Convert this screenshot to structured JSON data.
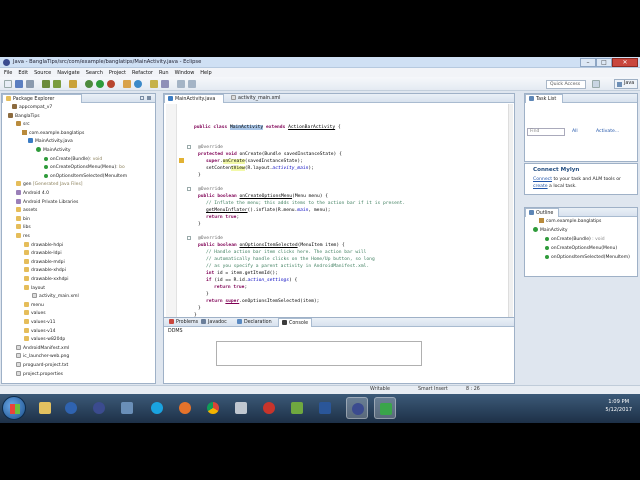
{
  "window": {
    "title": "Java - BanglaTips/src/com/example/banglatips/MainActivity.java - Eclipse",
    "controls": [
      "–",
      "□",
      "✕"
    ]
  },
  "menubar": {
    "items": [
      "File",
      "Edit",
      "Source",
      "Navigate",
      "Search",
      "Project",
      "Refactor",
      "Run",
      "Window",
      "Help"
    ]
  },
  "toolbar": {
    "quick_access": "Quick Access",
    "perspective": "Java"
  },
  "package_explorer": {
    "tab": "Package Explorer",
    "tree": [
      {
        "label": "appcompat_v7",
        "icon": "project",
        "suffix": ""
      },
      {
        "label": "BanglaTips",
        "icon": "project",
        "suffix": ""
      },
      {
        "label": "src",
        "icon": "source-folder",
        "suffix": ""
      },
      {
        "label": "com.example.banglatips",
        "icon": "package",
        "suffix": ""
      },
      {
        "label": "MainActivity.java",
        "icon": "java-file",
        "suffix": ""
      },
      {
        "label": "MainActivity",
        "icon": "class",
        "suffix": ""
      },
      {
        "label": "onCreate(Bundle)",
        "icon": "method",
        "suffix": ": void"
      },
      {
        "label": "onCreateOptionsMenu(Menu)",
        "icon": "method",
        "suffix": ": bo"
      },
      {
        "label": "onOptionsItemSelected(MenuItem",
        "icon": "method",
        "suffix": ""
      },
      {
        "label": "gen",
        "icon": "folder",
        "suffix": " [Generated Java Files]"
      },
      {
        "label": "Android 4.0",
        "icon": "library",
        "suffix": ""
      },
      {
        "label": "Android Private Libraries",
        "icon": "library",
        "suffix": ""
      },
      {
        "label": "assets",
        "icon": "folder",
        "suffix": ""
      },
      {
        "label": "bin",
        "icon": "folder",
        "suffix": ""
      },
      {
        "label": "libs",
        "icon": "folder",
        "suffix": ""
      },
      {
        "label": "res",
        "icon": "folder",
        "suffix": ""
      },
      {
        "label": "drawable-hdpi",
        "icon": "folder",
        "suffix": ""
      },
      {
        "label": "drawable-ldpi",
        "icon": "folder",
        "suffix": ""
      },
      {
        "label": "drawable-mdpi",
        "icon": "folder",
        "suffix": ""
      },
      {
        "label": "drawable-xhdpi",
        "icon": "folder",
        "suffix": ""
      },
      {
        "label": "drawable-xxhdpi",
        "icon": "folder",
        "suffix": ""
      },
      {
        "label": "layout",
        "icon": "folder",
        "suffix": ""
      },
      {
        "label": "activity_main.xml",
        "icon": "file",
        "suffix": ""
      },
      {
        "label": "menu",
        "icon": "folder",
        "suffix": ""
      },
      {
        "label": "values",
        "icon": "folder",
        "suffix": ""
      },
      {
        "label": "values-v11",
        "icon": "folder",
        "suffix": ""
      },
      {
        "label": "values-v14",
        "icon": "folder",
        "suffix": ""
      },
      {
        "label": "values-w820dp",
        "icon": "folder",
        "suffix": ""
      },
      {
        "label": "AndroidManifest.xml",
        "icon": "file",
        "suffix": ""
      },
      {
        "label": "ic_launcher-web.png",
        "icon": "file",
        "suffix": ""
      },
      {
        "label": "proguard-project.txt",
        "icon": "file",
        "suffix": ""
      },
      {
        "label": "project.properties",
        "icon": "file",
        "suffix": ""
      }
    ]
  },
  "editor": {
    "tabs": [
      "MainActivity.java",
      "activity_main.xml"
    ],
    "code": {
      "l1_kw": "public class ",
      "l1_cls": "MainActivity",
      "l1_ext": " extends ",
      "l1_super": "ActionBarActivity",
      "l1_end": " {",
      "override": "@Override",
      "l3_kw": "protected void ",
      "l3_name": "onCreate",
      "l3_params": "(Bundle savedInstanceState) {",
      "l4_super": "super",
      "l4_dot": ".",
      "l4_call": "onCreate",
      "l4_args": "(savedInstanceState);",
      "l5_a": "setConten",
      "l5_b": "tView",
      "l5_c": "(R.layout.",
      "l5_field": "activity_main",
      "l5_end": ");",
      "close": "}",
      "l8_kw": "public boolean ",
      "l8_name": "onCreateOptionsMenu",
      "l8_params": "(Menu menu) {",
      "l9": "// Inflate the menu; this adds items to the action bar if it is present.",
      "l10_a": "getMenuInflater",
      "l10_b": "().inflate(R.menu.",
      "l10_field": "main",
      "l10_c": ", menu);",
      "ret": "return ",
      "true_kw": "true",
      "l15_kw": "public boolean ",
      "l15_name": "onOptionsItemSelected",
      "l15_params": "(MenuItem item) {",
      "l16": "// Handle action bar item clicks here. The action bar will",
      "l17": "// automatically handle clicks on the Home/Up button, so long",
      "l18": "// as you specify a parent activity in AndroidManifest.xml.",
      "l19_kw": "int ",
      "l19_rest": "id = item.getItemId();",
      "l20_kw": "if ",
      "l20_a": "(id == R.id.",
      "l20_field": "action_settings",
      "l20_b": ") {",
      "l23_b": "super",
      "l23_c": ".onOptionsItemSelected(item);"
    }
  },
  "task_list": {
    "tab": "Task List",
    "find_placeholder": "Find",
    "all": "All",
    "activate": "Activate..."
  },
  "connect_mylyn": {
    "title": "Connect Mylyn",
    "line1_link": "Connect",
    "line1_rest": " to your task and ALM tools or",
    "line2_link": "create",
    "line2_rest": " a local task."
  },
  "outline": {
    "tab": "Outline",
    "items": [
      {
        "label": "com.example.banglatips",
        "suffix": ""
      },
      {
        "label": "MainActivity",
        "suffix": ""
      },
      {
        "label": "onCreate(Bundle)",
        "suffix": " : void"
      },
      {
        "label": "onCreateOptionsMenu(Menu)",
        "suffix": ""
      },
      {
        "label": "onOptionsItemSelected(MenuItem)",
        "suffix": ""
      }
    ]
  },
  "bottom_panel": {
    "tabs": [
      "Problems",
      "Javadoc",
      "Declaration",
      "Console"
    ],
    "console_label": "DDMS"
  },
  "statusbar": {
    "mode": "Writable",
    "insert": "Smart Insert",
    "position": "8 : 26"
  },
  "taskbar": {
    "time": "1:09 PM",
    "date": "5/12/2017"
  }
}
